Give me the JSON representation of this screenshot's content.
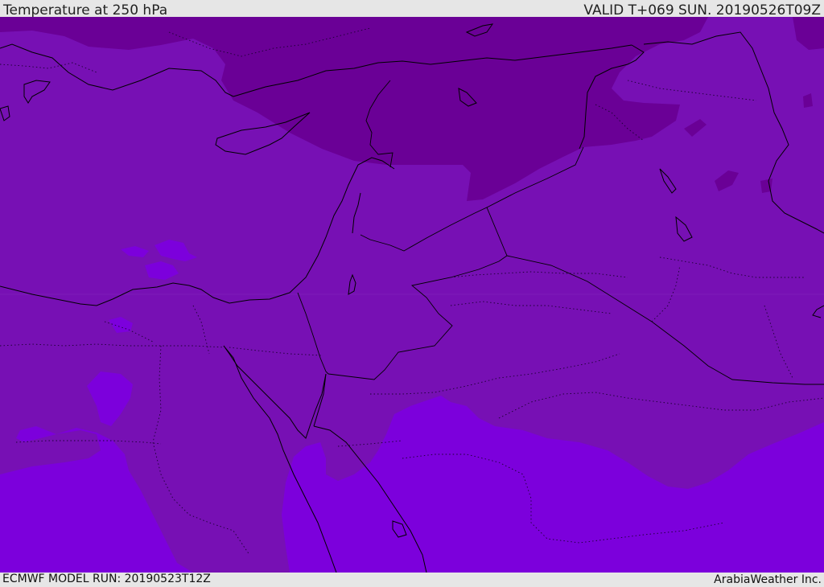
{
  "header": {
    "title": "Temperature at 250 hPa",
    "valid_time": "VALID T+069 SUN. 20190526T09Z"
  },
  "footer": {
    "model_run": "ECMWF MODEL RUN: 20190523T12Z",
    "credit": "ArabiaWeather Inc."
  },
  "colors": {
    "band_dark": "#6a0096",
    "band_mid": "#7710b4",
    "band_light": "#7c00dc",
    "coast": "#000000"
  }
}
